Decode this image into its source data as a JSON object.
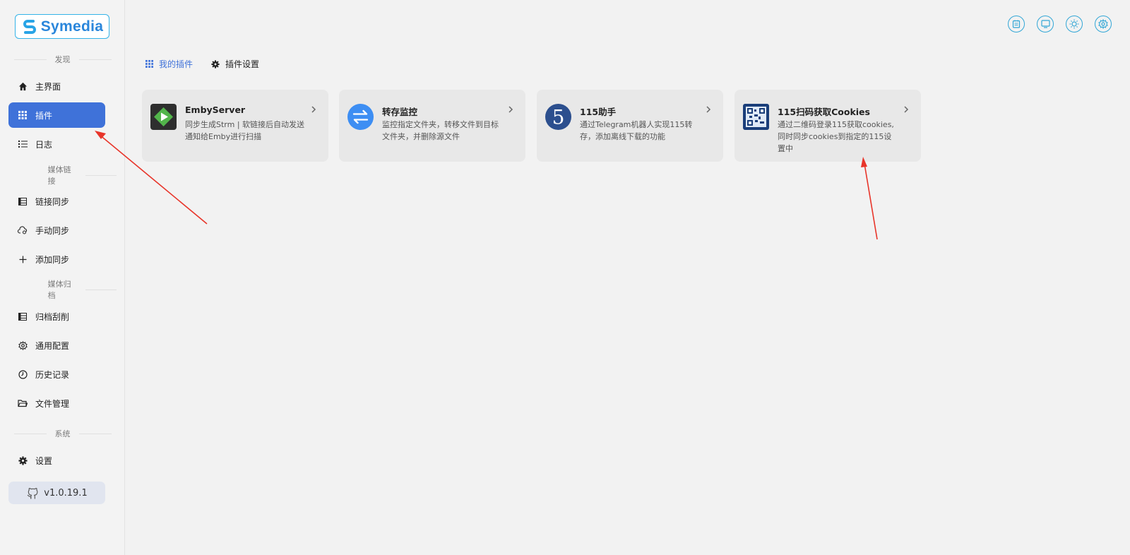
{
  "app": {
    "logo_text": "Symedia",
    "version": "v1.0.19.1",
    "accent": "#3f72d9",
    "icon_accent": "#31a6d6"
  },
  "sidebar": {
    "sections": [
      {
        "title": "发现"
      },
      {
        "title": "媒体链接"
      },
      {
        "title": "媒体归档"
      },
      {
        "title": "系统"
      }
    ],
    "items": [
      {
        "label": "主界面",
        "icon": "home-icon"
      },
      {
        "label": "插件",
        "icon": "grid-icon",
        "active": true
      },
      {
        "label": "日志",
        "icon": "list-icon"
      },
      {
        "label": "链接同步",
        "icon": "table-icon"
      },
      {
        "label": "手动同步",
        "icon": "cloud-sync-icon"
      },
      {
        "label": "添加同步",
        "icon": "plus-icon"
      },
      {
        "label": "归档刮削",
        "icon": "table-icon"
      },
      {
        "label": "通用配置",
        "icon": "cog-icon"
      },
      {
        "label": "历史记录",
        "icon": "clock-icon"
      },
      {
        "label": "文件管理",
        "icon": "folder-icon"
      },
      {
        "label": "设置",
        "icon": "gear-icon"
      }
    ]
  },
  "header": {
    "icons": [
      "calendar-icon",
      "monitor-icon",
      "sun-icon",
      "settings-icon"
    ]
  },
  "tabs": [
    {
      "label": "我的插件",
      "icon": "grid-icon",
      "active": true
    },
    {
      "label": "插件设置",
      "icon": "gear-icon"
    }
  ],
  "plugins": [
    {
      "title": "EmbyServer",
      "desc": "同步生成Strm | 软链接后自动发送通知给Emby进行扫描",
      "icon": "emby-icon"
    },
    {
      "title": "转存监控",
      "desc": "监控指定文件夹，转移文件到目标文件夹，并删除源文件",
      "icon": "transfer-icon"
    },
    {
      "title": "115助手",
      "desc": "通过Telegram机器人实现115转存，添加离线下载的功能",
      "icon": "115-icon"
    },
    {
      "title": "115扫码获取Cookies",
      "desc": "通过二维码登录115获取cookies,同时同步cookies到指定的115设置中",
      "icon": "qrcode-icon"
    }
  ]
}
